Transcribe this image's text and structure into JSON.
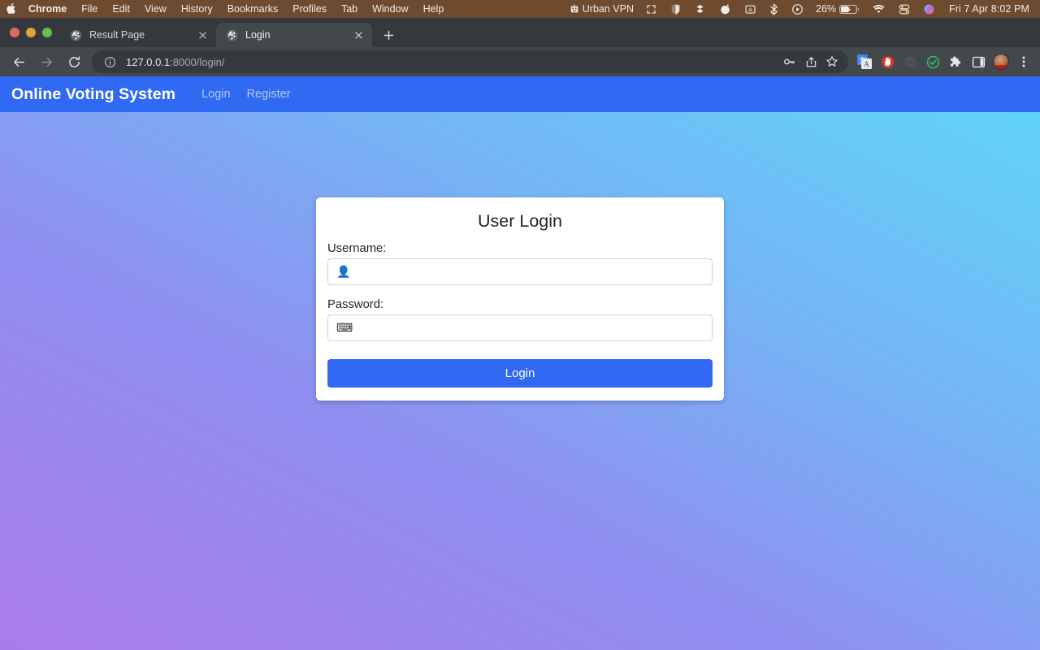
{
  "menubar": {
    "apple_icon": "apple-logo",
    "items": [
      {
        "label": "Chrome",
        "bold": true
      },
      {
        "label": "File",
        "bold": false
      },
      {
        "label": "Edit",
        "bold": false
      },
      {
        "label": "View",
        "bold": false
      },
      {
        "label": "History",
        "bold": false
      },
      {
        "label": "Bookmarks",
        "bold": false
      },
      {
        "label": "Profiles",
        "bold": false
      },
      {
        "label": "Tab",
        "bold": false
      },
      {
        "label": "Window",
        "bold": false
      },
      {
        "label": "Help",
        "bold": false
      }
    ],
    "status": {
      "vpn_label": "Urban VPN",
      "battery_percent": "26%",
      "clock": "Fri 7 Apr  8:02 PM",
      "icons": [
        "urban-vpn-icon",
        "screen-mirroring-icon",
        "bitwarden-icon",
        "dropbox-icon",
        "grammarly-icon",
        "text-input-icon",
        "bluetooth-icon",
        "now-playing-icon",
        "battery-charging-icon",
        "wifi-icon",
        "control-center-icon",
        "siri-icon"
      ]
    },
    "background_color": "#6e4a2e"
  },
  "browser": {
    "window_controls": [
      "close-button",
      "minimize-button",
      "maximize-button"
    ],
    "tabs": [
      {
        "title": "Result Page",
        "active": false,
        "favicon": "globe-icon"
      },
      {
        "title": "Login",
        "active": true,
        "favicon": "globe-icon"
      }
    ],
    "new_tab_label": "+",
    "toolbar": {
      "back_icon": "back-arrow-icon",
      "forward_icon": "forward-arrow-icon",
      "reload_icon": "reload-icon",
      "site_info_icon": "info-circle-icon",
      "url_host": "127.0.0.1",
      "url_path": ":8000/login/",
      "url_full": "127.0.0.1:8000/login/",
      "omnibox_icons": [
        "password-key-icon",
        "share-icon",
        "bookmark-star-icon"
      ],
      "extension_icons": [
        "google-translate-icon",
        "adblock-icon",
        "dark-reader-icon",
        "checkmark-extension-icon",
        "extensions-puzzle-icon",
        "side-panel-icon"
      ],
      "profile_icon": "profile-avatar",
      "menu_icon": "three-dot-menu-icon"
    },
    "colors": {
      "tab_strip": "#35393d",
      "toolbar": "#43484d",
      "active_tab": "#43484d"
    }
  },
  "page": {
    "navbar": {
      "brand": "Online Voting System",
      "links": [
        {
          "label": "Login"
        },
        {
          "label": "Register"
        }
      ],
      "background_color": "#316af2"
    },
    "background": {
      "gradient_from": "#ab7ce9",
      "gradient_to": "#60d4f8",
      "direction": "to top right"
    },
    "login_card": {
      "title": "User Login",
      "username": {
        "label": "Username:",
        "value": "👤",
        "placeholder": "",
        "icon": "person-icon"
      },
      "password": {
        "label": "Password:",
        "value": "⌨",
        "placeholder": "",
        "icon": "keyboard-icon"
      },
      "submit_label": "Login",
      "submit_color": "#316af2"
    }
  }
}
